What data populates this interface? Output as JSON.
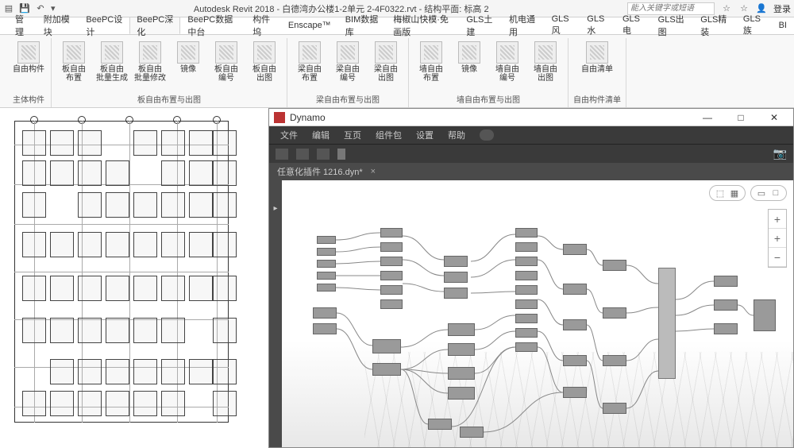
{
  "titlebar": {
    "app": "Autodesk Revit 2018 - ",
    "file": "白德湾办公楼1-2单元 2-4F0322.rvt - 结构平面: 标高 2",
    "search_placeholder": "能入关键字或短语",
    "login": "登录"
  },
  "qat": {
    "save": "",
    "undo": "",
    "redo": "",
    "dropdown": "▾"
  },
  "tabs": [
    "管理",
    "附加模块",
    "BeePC设计",
    "BeePC深化",
    "BeePC数据中台",
    "构件坞",
    "Enscape™",
    "BIM数据库",
    "梅椒山快模·免画版",
    "GLS土建",
    "机电通用",
    "GLS风",
    "GLS水",
    "GLS电",
    "GLS出图",
    "GLS精装",
    "GLS族",
    "BI"
  ],
  "active_tab": 3,
  "ribbon": {
    "groups": [
      {
        "label": "主体构件",
        "buttons": [
          {
            "label": "自由构件"
          }
        ]
      },
      {
        "label": "板自由布置与出图",
        "buttons": [
          {
            "label": "板自由\n布置"
          },
          {
            "label": "板自由\n批量生成"
          },
          {
            "label": "板自由\n批量修改"
          },
          {
            "label": "镜像"
          },
          {
            "label": "板自由\n编号"
          },
          {
            "label": "板自由\n出图"
          }
        ]
      },
      {
        "label": "梁自由布置与出图",
        "buttons": [
          {
            "label": "梁自由\n布置"
          },
          {
            "label": "梁自由\n编号"
          },
          {
            "label": "梁自由\n出图"
          }
        ]
      },
      {
        "label": "墙自由布置与出图",
        "buttons": [
          {
            "label": "墙自由\n布置"
          },
          {
            "label": "镜像"
          },
          {
            "label": "墙自由\n编号"
          },
          {
            "label": "墙自由\n出图"
          }
        ]
      },
      {
        "label": "自由构件清单",
        "buttons": [
          {
            "label": "自由清单"
          }
        ]
      }
    ]
  },
  "dynamo": {
    "title": "Dynamo",
    "menus": [
      "文件",
      "编辑",
      "互页",
      "组件包",
      "设置",
      "帮助"
    ],
    "tabname": "任意化插件 1216.dyn*",
    "min": "—",
    "max": "□",
    "close": "✕",
    "zoom_controls": [
      "+",
      "+",
      "−"
    ]
  }
}
